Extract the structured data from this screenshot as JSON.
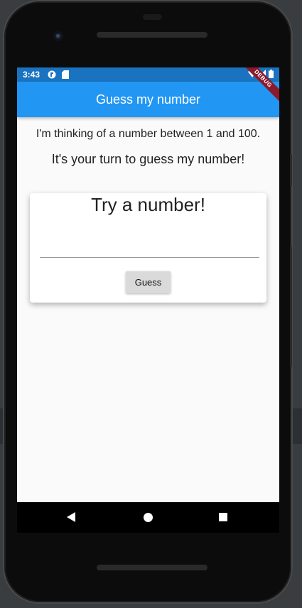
{
  "status_bar": {
    "time": "3:43",
    "icons": [
      "notification-icon",
      "sd-card-icon",
      "wifi-icon",
      "signal-icon",
      "battery-icon"
    ]
  },
  "app_bar": {
    "title": "Guess my number",
    "color": "#2196f3"
  },
  "debug_banner": {
    "label": "DEBUG"
  },
  "intro": {
    "line1": "I'm thinking of a number between 1 and 100.",
    "line2": "It's your turn to guess my number!"
  },
  "card": {
    "title": "Try a number!",
    "input_value": "",
    "button_label": "Guess"
  },
  "nav_bar": {
    "icons": [
      "back-icon",
      "home-icon",
      "recents-icon"
    ]
  }
}
